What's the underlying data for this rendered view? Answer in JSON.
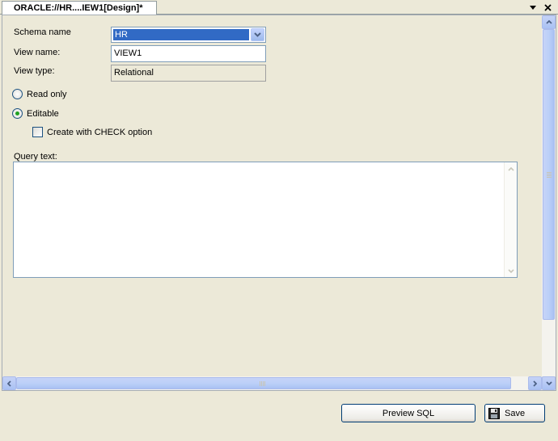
{
  "tab": {
    "title": "ORACLE://HR....IEW1[Design]*"
  },
  "icons": {
    "dropdown": "chevron-down-icon",
    "close": "close-icon",
    "save": "floppy-disk-icon"
  },
  "form": {
    "schema_label": "Schema name",
    "schema_value": "HR",
    "view_name_label": "View name:",
    "view_name_value": "VIEW1",
    "view_type_label": "View type:",
    "view_type_value": "Relational",
    "read_only_label": "Read only",
    "editable_label": "Editable",
    "editable_selected": true,
    "check_option_label": "Create with CHECK option",
    "check_option_checked": false,
    "query_label": "Query text:",
    "query_value": ""
  },
  "buttons": {
    "preview_sql": "Preview SQL",
    "save": "Save"
  },
  "colors": {
    "selection": "#316ac5",
    "radio_dot": "#21a121",
    "window_bg": "#ece9d8"
  }
}
